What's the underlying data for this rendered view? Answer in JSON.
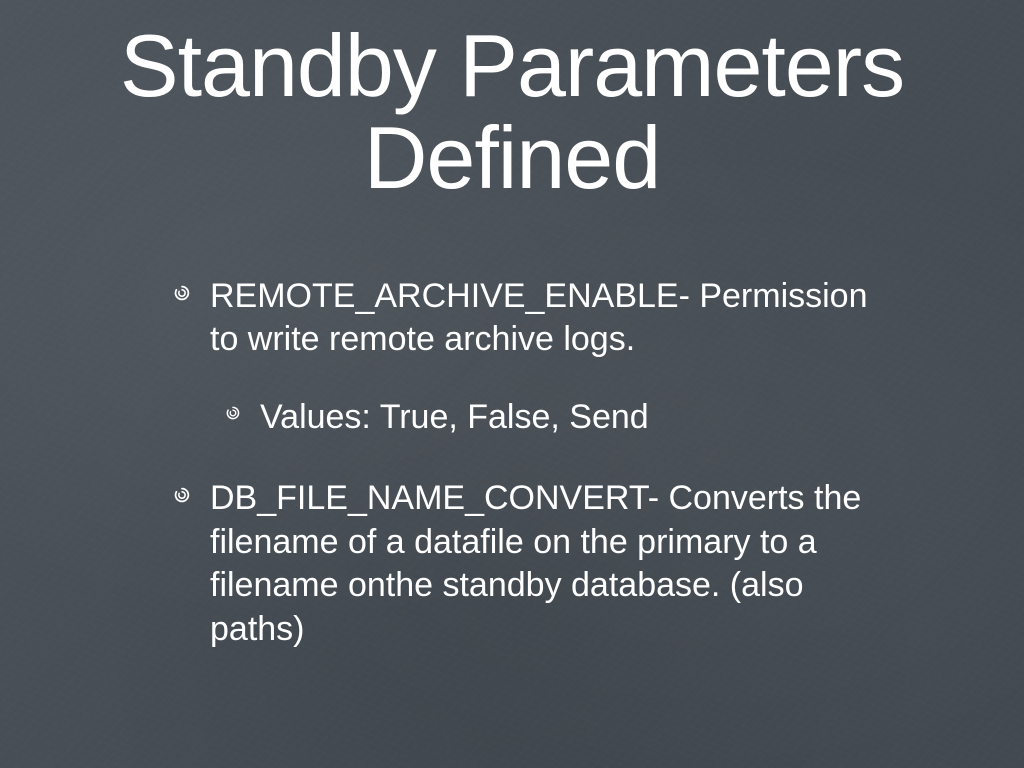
{
  "title": "Standby Parameters Defined",
  "bullets": [
    {
      "text": "REMOTE_ARCHIVE_ENABLE- Permission to write remote archive logs.",
      "sub": [
        {
          "text": "Values: True, False, Send"
        }
      ]
    },
    {
      "text": "DB_FILE_NAME_CONVERT- Converts the filename of a datafile on the primary to a filename onthe standby database. (also paths)",
      "sub": []
    }
  ]
}
